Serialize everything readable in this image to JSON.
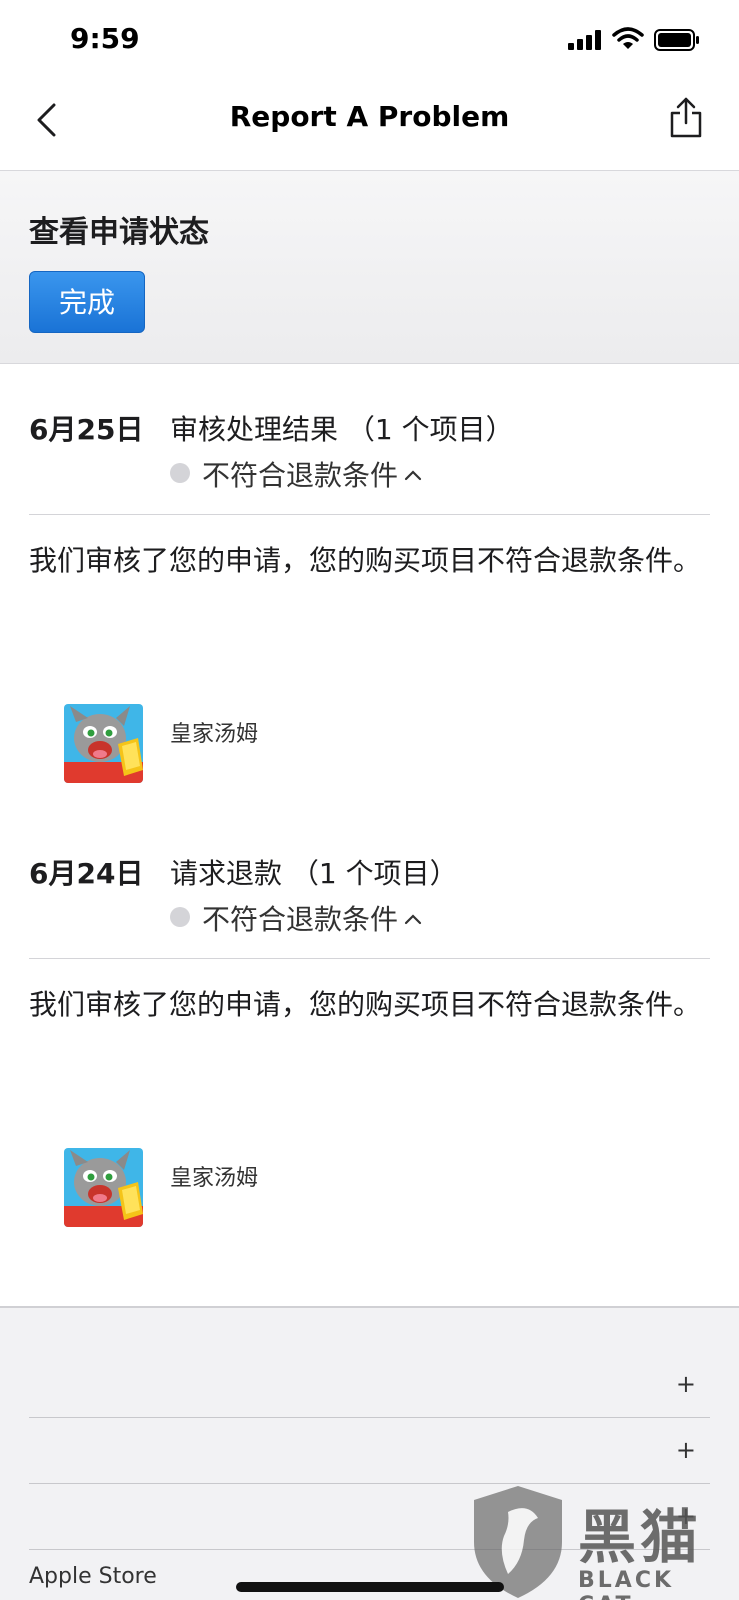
{
  "status_bar": {
    "time": "9:59"
  },
  "nav": {
    "title": "Report A Problem"
  },
  "header": {
    "title": "查看申请状态",
    "done_label": "完成"
  },
  "entries": [
    {
      "date": "6月25日",
      "title": "审核处理结果 （1 个项目）",
      "status": "不符合退款条件",
      "message": "我们审核了您的申请，您的购买项目不符合退款条件。",
      "app_name": "皇家汤姆"
    },
    {
      "date": "6月24日",
      "title": "请求退款 （1 个项目）",
      "status": "不符合退款条件",
      "message": "我们审核了您的申请，您的购买项目不符合退款条件。",
      "app_name": "皇家汤姆"
    }
  ],
  "footer": {
    "rows": [
      {
        "label": "",
        "icon": "plus-icon"
      },
      {
        "label": "",
        "icon": "plus-icon"
      },
      {
        "label": "",
        "icon": "plus-icon"
      }
    ],
    "apple_store_label": "Apple Store"
  },
  "watermark": {
    "text": "黑猫",
    "sub": "BLACK CAT"
  },
  "colors": {
    "accent": "#1a73d6",
    "status_dot": "#d4d4d8"
  }
}
